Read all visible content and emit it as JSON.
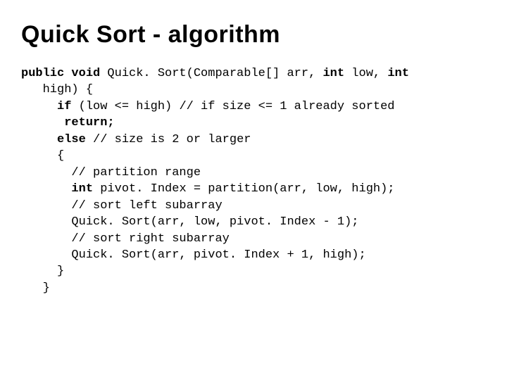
{
  "title": "Quick Sort - algorithm",
  "code": {
    "l1a": "public void",
    "l1b": " Quick. Sort(Comparable[] arr, ",
    "l1c": "int",
    "l1d": " low, ",
    "l1e": "int",
    "l2a": "   high) {",
    "l3a": "     if",
    "l3b": " (low <= high) // if size <= 1 already sorted",
    "l4a": "      return;",
    "l5a": "     else",
    "l5b": " // size is 2 or larger",
    "l6a": "     {",
    "l7a": "       // partition range",
    "l8a": "       int",
    "l8b": " pivot. Index = partition(arr, low, high);",
    "l9a": "       // sort left subarray",
    "l10a": "       Quick. Sort(arr, low, pivot. Index - 1);",
    "l11a": "       // sort right subarray",
    "l12a": "       Quick. Sort(arr, pivot. Index + 1, high);",
    "l13a": "     }",
    "l14a": "   }"
  }
}
